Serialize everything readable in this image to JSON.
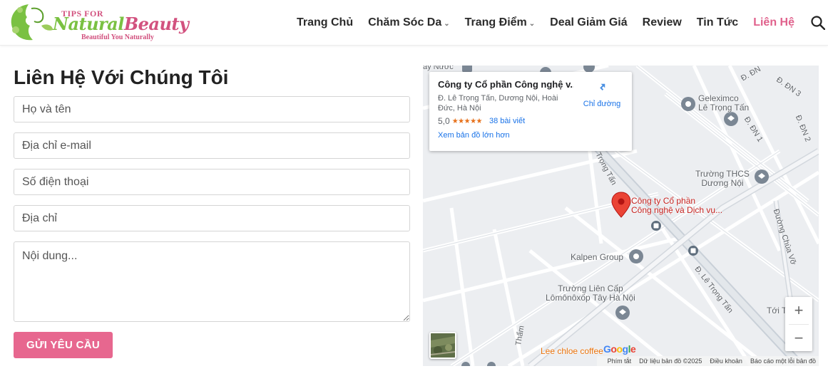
{
  "logo": {
    "tips": "TIPS FOR",
    "main_green": "Natural",
    "main_pink": "Beauty",
    "tagline": "Beautiful You Naturally",
    "colors": {
      "green": "#7ac142",
      "pink": "#d2527f"
    }
  },
  "nav": {
    "items": [
      {
        "label": "Trang Chủ",
        "dropdown": false
      },
      {
        "label": "Chăm Sóc Da",
        "dropdown": true
      },
      {
        "label": "Trang Điểm",
        "dropdown": true
      },
      {
        "label": "Deal Giảm Giá",
        "dropdown": false
      },
      {
        "label": "Review",
        "dropdown": false
      },
      {
        "label": "Tin Tức",
        "dropdown": false
      },
      {
        "label": "Liên Hệ",
        "dropdown": false,
        "active": true
      }
    ],
    "search_icon": "search-icon",
    "active_color": "#e0618c"
  },
  "form": {
    "title": "Liên Hệ Với Chúng Tôi",
    "fields": {
      "name_placeholder": "Họ và tên",
      "email_placeholder": "Địa chỉ e-mail",
      "phone_placeholder": "Số điện thoại",
      "address_placeholder": "Địa chỉ",
      "message_placeholder": "Nội dung..."
    },
    "submit_label": "GỬI YÊU CẦU",
    "submit_color": "#e7678f"
  },
  "map": {
    "card": {
      "name": "Công ty Cổ phần Công nghệ v...",
      "address": "Đ. Lê Trọng Tấn, Dương Nội, Hoài Đức, Hà Nội",
      "rating": "5,0",
      "stars": "★★★★★",
      "reviews": "38 bài viết",
      "bigger_map": "Xem bản đồ lớn hơn",
      "directions": "Chỉ đường"
    },
    "labels": {
      "marker_line1": "Công ty Cổ phần",
      "marker_line2": "Công nghệ và Dịch vụ...",
      "geleximco_1": "Geleximco",
      "geleximco_2": "Lê Trọng Tấn",
      "school_1": "Trường THCS",
      "school_2": "Dương Nội",
      "kalpen": "Kalpen Group",
      "lienCap_1": "Trường Liên Cấp",
      "lienCap_2": "Lômônôxốp Tây Hà Nội",
      "lee_chloe": "Lee chloe coffee",
      "toi_t": "Tới T",
      "nuoc": "ay Nước",
      "tham": "Thẩm",
      "street_trong_tan": "Trọng Tấn",
      "street_le_trong_tan": "Đ. Lê Trọng Tấn",
      "street_chua_vo": "Đường Chùa Vỡ",
      "street_dn3": "Đ. ĐN 3",
      "street_dn2": "Đ. ĐN 2",
      "street_dn1": "Đ. ĐN 1",
      "street_dn": "Đ. ĐN"
    },
    "zoom_in": "+",
    "zoom_out": "−",
    "google": [
      "G",
      "o",
      "o",
      "g",
      "l",
      "e"
    ],
    "google_colors": [
      "#4285f4",
      "#ea4335",
      "#fbbc05",
      "#4285f4",
      "#34a853",
      "#ea4335"
    ],
    "footer": {
      "shortcuts": "Phím tắt",
      "data": "Dữ liệu bản đồ ©2025",
      "terms": "Điều khoản",
      "report": "Báo cáo một lỗi bản đồ"
    }
  }
}
